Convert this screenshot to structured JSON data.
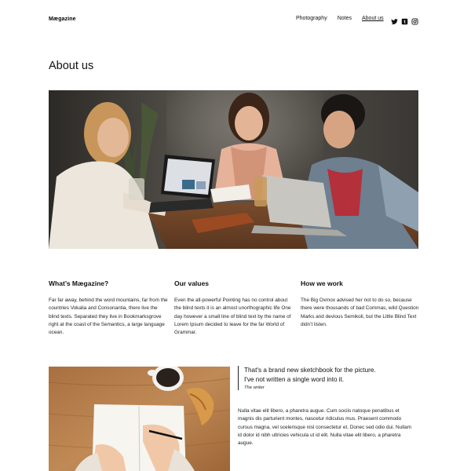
{
  "header": {
    "site_title": "Mægazine",
    "nav": [
      {
        "label": "Photography",
        "current": false
      },
      {
        "label": "Notes",
        "current": false
      },
      {
        "label": "About us",
        "current": true
      }
    ],
    "social_icons": [
      "twitter-icon",
      "tumblr-icon",
      "instagram-icon"
    ]
  },
  "page": {
    "title": "About us"
  },
  "columns": [
    {
      "heading": "What’s Mægazine?",
      "text": "Far far away, behind the word mountains, far from the countries Vokalia and Consonantia, there live the blind texts. Separated they live in Bookmarksgrove right at the coast of the Semantics, a large language ocean."
    },
    {
      "heading": "Our values",
      "text": "Even the all-powerful Pointing has no control about the blind texts it is an almost unorthographic life One day however a small line of blind text by the name of Lorem Ipsum decided to leave for the far World of Grammar."
    },
    {
      "heading": "How we work",
      "text": "The Big Oxmox advised her not to do so, because there were thousands of bad Commas, wild Question Marks and devious Semikoli, but the Little Blind Text didn’t listen."
    }
  ],
  "quote": {
    "text": "That's a brand new sketchbook for the picture. I've not written a single word into it.",
    "cite": "The writer"
  },
  "body_text": "Nulla vitae elit libero, a pharetra augue. Cum sociis natoque penatibus et magnis dis parturient montes, nascetur ridiculus mus. Praesent commodo cursus magna, vel scelerisque nisl consectetur et. Donec sed odio dui. Nullam id dolor id nibh ultricies vehicula ut id elit. Nulla vitae elit libero, a pharetra augue.",
  "colors": {
    "text": "#111111",
    "background": "#ffffff",
    "hero_wall": "#3d3a36",
    "table_wood": "#b07a4a"
  }
}
